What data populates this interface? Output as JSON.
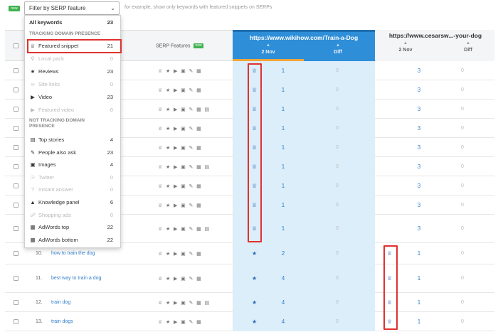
{
  "topbar": {
    "new_badge": "new",
    "filter_label": "Filter by SERP feature",
    "hint": "for example, show only keywords with featured snippets on SERPs"
  },
  "table": {
    "serp_header": "SERP Features",
    "serp_new_badge": "new",
    "site_a": {
      "url": "https://www.wikihow.com/Train-a-Dog",
      "date": "2 Nov",
      "diff": "Diff"
    },
    "site_b": {
      "url": "https://www.cesarsw...-your-dog",
      "date": "2 Nov",
      "diff": "Diff"
    },
    "rows": [
      {
        "num": "",
        "keyword": "",
        "crown_a": true,
        "pos_a": "1",
        "diff_a": "0",
        "crown_b": false,
        "pos_b": "3",
        "diff_b": "0"
      },
      {
        "num": "",
        "keyword": "",
        "crown_a": true,
        "pos_a": "1",
        "diff_a": "0",
        "crown_b": false,
        "pos_b": "3",
        "diff_b": "0"
      },
      {
        "num": "",
        "keyword": "",
        "crown_a": true,
        "pos_a": "1",
        "diff_a": "0",
        "crown_b": false,
        "pos_b": "3",
        "diff_b": "0"
      },
      {
        "num": "",
        "keyword": "",
        "crown_a": true,
        "pos_a": "1",
        "diff_a": "0",
        "crown_b": false,
        "pos_b": "3",
        "diff_b": "0"
      },
      {
        "num": "",
        "keyword": "",
        "crown_a": true,
        "pos_a": "1",
        "diff_a": "0",
        "crown_b": false,
        "pos_b": "3",
        "diff_b": "0"
      },
      {
        "num": "",
        "keyword": "",
        "crown_a": true,
        "pos_a": "1",
        "diff_a": "0",
        "crown_b": false,
        "pos_b": "3",
        "diff_b": "0"
      },
      {
        "num": "",
        "keyword": "",
        "crown_a": true,
        "pos_a": "1",
        "diff_a": "0",
        "crown_b": false,
        "pos_b": "3",
        "diff_b": "0"
      },
      {
        "num": "",
        "keyword": "",
        "crown_a": true,
        "pos_a": "1",
        "diff_a": "0",
        "crown_b": false,
        "pos_b": "3",
        "diff_b": "0"
      },
      {
        "num": "",
        "keyword": "",
        "crown_a": true,
        "pos_a": "1",
        "diff_a": "0",
        "crown_b": false,
        "pos_b": "3",
        "diff_b": "0"
      },
      {
        "num": "10.",
        "keyword": "how to train the dog",
        "crown_a": false,
        "pos_a": "2",
        "diff_a": "0",
        "crown_b": true,
        "pos_b": "1",
        "diff_b": "0"
      },
      {
        "num": "11.",
        "keyword": "best way to train a dog",
        "crown_a": false,
        "pos_a": "4",
        "diff_a": "0",
        "crown_b": true,
        "pos_b": "1",
        "diff_b": "0"
      },
      {
        "num": "12.",
        "keyword": "train dog",
        "crown_a": false,
        "pos_a": "4",
        "diff_a": "0",
        "crown_b": true,
        "pos_b": "1",
        "diff_b": "0"
      },
      {
        "num": "13.",
        "keyword": "train dogs",
        "crown_a": false,
        "pos_a": "4",
        "diff_a": "0",
        "crown_b": true,
        "pos_b": "1",
        "diff_b": "0"
      }
    ]
  },
  "dropdown": {
    "all_keywords": {
      "label": "All keywords",
      "count": "23"
    },
    "heading_tracking": "TRACKING DOMAIN PRESENCE",
    "tracking_items": [
      {
        "icon": "crown-icon",
        "label": "Featured snippet",
        "count": "21",
        "enabled": true
      },
      {
        "icon": "pin-icon",
        "label": "Local pack",
        "count": "0",
        "enabled": false
      },
      {
        "icon": "star-icon",
        "label": "Reviews",
        "count": "23",
        "enabled": true
      },
      {
        "icon": "link-icon",
        "label": "Site links",
        "count": "0",
        "enabled": false
      },
      {
        "icon": "video-icon",
        "label": "Video",
        "count": "23",
        "enabled": true
      },
      {
        "icon": "video-icon",
        "label": "Featured video",
        "count": "0",
        "enabled": false
      }
    ],
    "heading_not_tracking": "NOT TRACKING DOMAIN PRESENCE",
    "not_tracking_items": [
      {
        "icon": "newspaper-icon",
        "label": "Top stories",
        "count": "4",
        "enabled": true
      },
      {
        "icon": "chat-icon",
        "label": "People also ask",
        "count": "23",
        "enabled": true
      },
      {
        "icon": "image-icon",
        "label": "Images",
        "count": "4",
        "enabled": true
      },
      {
        "icon": "twitter-icon",
        "label": "Twitter",
        "count": "0",
        "enabled": false
      },
      {
        "icon": "question-icon",
        "label": "Instant answer",
        "count": "0",
        "enabled": false
      },
      {
        "icon": "graduation-icon",
        "label": "Knowledge panel",
        "count": "6",
        "enabled": true
      },
      {
        "icon": "cart-icon",
        "label": "Shopping ads",
        "count": "0",
        "enabled": false
      },
      {
        "icon": "ad-icon",
        "label": "AdWords top",
        "count": "22",
        "enabled": true
      },
      {
        "icon": "ad-icon",
        "label": "AdWords bottom",
        "count": "22",
        "enabled": true
      }
    ]
  },
  "colors": {
    "accent_blue": "#2e8ed8",
    "highlight_red": "#e0312f",
    "new_green": "#3fb24f",
    "column_tint": "#dceefa"
  }
}
